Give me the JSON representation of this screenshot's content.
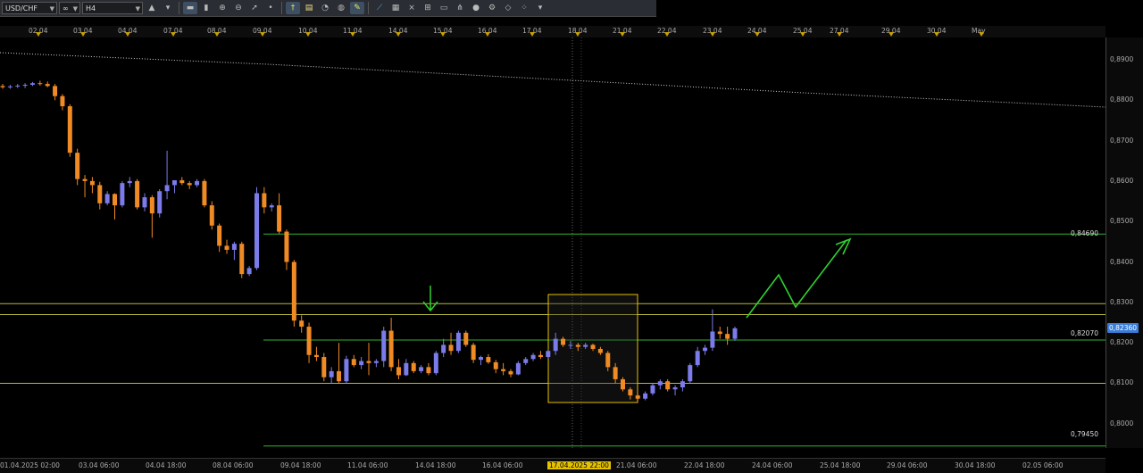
{
  "toolbar": {
    "symbol": "USD/CHF",
    "chart_style": "∞",
    "timeframe": "H4",
    "icons": [
      "chart-type-icon",
      "bar-chart-icon",
      "candle-chart-icon",
      "zoom-in-icon",
      "zoom-out-icon",
      "cursor-icon",
      "dot-icon",
      "crosshair-icon",
      "note-icon",
      "clock-icon",
      "globe-icon",
      "pencil-icon",
      "trendline-icon",
      "channel-icon",
      "fibonacci-icon",
      "grid-icon",
      "rect-icon",
      "pitchfork-icon",
      "circle-icon",
      "settings-icon",
      "eraser-icon",
      "more-icon"
    ]
  },
  "top_dates": [
    "02.04",
    "03.04",
    "04.04",
    "07.04",
    "08.04",
    "09.04",
    "10.04",
    "11.04",
    "14.04",
    "15.04",
    "16.04",
    "17.04",
    "18.04",
    "21.04",
    "22.04",
    "23.04",
    "24.04",
    "25.04",
    "27.04",
    "29.04",
    "30.04",
    "May"
  ],
  "bottom_dates": [
    "01.04.2025 02:00",
    "03.04 06:00",
    "04.04 18:00",
    "08.04 06:00",
    "09.04 18:00",
    "11.04 06:00",
    "14.04 18:00",
    "16.04 06:00",
    "17.04.2025 22:00",
    "21.04 06:00",
    "22.04 18:00",
    "24.04 06:00",
    "25.04 18:00",
    "29.04 06:00",
    "30.04 18:00",
    "02.05 06:00"
  ],
  "highlight_date": "17.04.2025 22:00",
  "y_ticks": [
    "0,8900",
    "0,8800",
    "0,8700",
    "0,8600",
    "0,8500",
    "0,8400",
    "0,8300",
    "0,8200",
    "0,8100",
    "0,8000"
  ],
  "levels": {
    "upper": "0,84690",
    "middle": "0,82070",
    "lower": "0,79450"
  },
  "current_price": "0,82360",
  "colors": {
    "bull": "#7b7bea",
    "bear": "#f08a24",
    "level_green": "#2fb52f",
    "level_yellow": "#b8b83a",
    "highlight": "#e6c200",
    "arrow_green": "#2fd12f",
    "price_tag": "#3a7dd8"
  },
  "chart_data": {
    "type": "candlestick",
    "title": "",
    "ylim": [
      0.794,
      0.8955
    ],
    "candles": [
      [
        0.8835,
        0.884,
        0.8828,
        0.8832
      ],
      [
        0.8832,
        0.8838,
        0.8828,
        0.8834
      ],
      [
        0.8834,
        0.884,
        0.883,
        0.8836
      ],
      [
        0.8836,
        0.8842,
        0.883,
        0.8838
      ],
      [
        0.8838,
        0.8845,
        0.8835,
        0.8842
      ],
      [
        0.8842,
        0.8848,
        0.8836,
        0.884
      ],
      [
        0.884,
        0.8846,
        0.8832,
        0.8835
      ],
      [
        0.8835,
        0.884,
        0.88,
        0.881
      ],
      [
        0.881,
        0.8815,
        0.8775,
        0.8785
      ],
      [
        0.8785,
        0.879,
        0.866,
        0.867
      ],
      [
        0.867,
        0.868,
        0.859,
        0.8605
      ],
      [
        0.8605,
        0.8615,
        0.856,
        0.86
      ],
      [
        0.86,
        0.861,
        0.857,
        0.859
      ],
      [
        0.859,
        0.8598,
        0.853,
        0.8545
      ],
      [
        0.8545,
        0.8575,
        0.854,
        0.8568
      ],
      [
        0.8568,
        0.857,
        0.8505,
        0.854
      ],
      [
        0.854,
        0.86,
        0.8535,
        0.8595
      ],
      [
        0.8595,
        0.861,
        0.8585,
        0.86
      ],
      [
        0.86,
        0.8605,
        0.853,
        0.8535
      ],
      [
        0.8535,
        0.857,
        0.8525,
        0.856
      ],
      [
        0.856,
        0.8565,
        0.846,
        0.852
      ],
      [
        0.852,
        0.858,
        0.851,
        0.8575
      ],
      [
        0.8575,
        0.8675,
        0.8555,
        0.859
      ],
      [
        0.859,
        0.8602,
        0.857,
        0.8602
      ],
      [
        0.8602,
        0.861,
        0.859,
        0.8595
      ],
      [
        0.8595,
        0.86,
        0.858,
        0.859
      ],
      [
        0.859,
        0.8605,
        0.8585,
        0.86
      ],
      [
        0.86,
        0.8605,
        0.8535,
        0.854
      ],
      [
        0.854,
        0.855,
        0.848,
        0.849
      ],
      [
        0.849,
        0.8495,
        0.8425,
        0.844
      ],
      [
        0.844,
        0.8455,
        0.842,
        0.843
      ],
      [
        0.843,
        0.845,
        0.8405,
        0.8445
      ],
      [
        0.8445,
        0.845,
        0.836,
        0.837
      ],
      [
        0.837,
        0.839,
        0.8365,
        0.8385
      ],
      [
        0.8385,
        0.8585,
        0.838,
        0.857
      ],
      [
        0.857,
        0.8585,
        0.852,
        0.8535
      ],
      [
        0.8535,
        0.8545,
        0.8525,
        0.854
      ],
      [
        0.854,
        0.857,
        0.847,
        0.8475
      ],
      [
        0.8475,
        0.848,
        0.838,
        0.84
      ],
      [
        0.84,
        0.8405,
        0.824,
        0.8255
      ],
      [
        0.8255,
        0.8268,
        0.8225,
        0.824
      ],
      [
        0.824,
        0.825,
        0.815,
        0.817
      ],
      [
        0.817,
        0.819,
        0.8155,
        0.8165
      ],
      [
        0.8165,
        0.8175,
        0.8105,
        0.8115
      ],
      [
        0.8115,
        0.814,
        0.81,
        0.813
      ],
      [
        0.813,
        0.82,
        0.81,
        0.8105
      ],
      [
        0.8105,
        0.8168,
        0.81,
        0.816
      ],
      [
        0.816,
        0.817,
        0.814,
        0.8145
      ],
      [
        0.8145,
        0.8165,
        0.8135,
        0.8155
      ],
      [
        0.8155,
        0.82,
        0.812,
        0.815
      ],
      [
        0.815,
        0.816,
        0.814,
        0.8155
      ],
      [
        0.8155,
        0.824,
        0.814,
        0.823
      ],
      [
        0.823,
        0.8262,
        0.813,
        0.814
      ],
      [
        0.814,
        0.816,
        0.811,
        0.812
      ],
      [
        0.812,
        0.816,
        0.8118,
        0.815
      ],
      [
        0.815,
        0.8155,
        0.8125,
        0.813
      ],
      [
        0.813,
        0.8145,
        0.8125,
        0.814
      ],
      [
        0.814,
        0.815,
        0.812,
        0.8125
      ],
      [
        0.8125,
        0.818,
        0.812,
        0.8175
      ],
      [
        0.8175,
        0.821,
        0.8165,
        0.8195
      ],
      [
        0.8195,
        0.8225,
        0.817,
        0.818
      ],
      [
        0.818,
        0.823,
        0.8175,
        0.8225
      ],
      [
        0.8225,
        0.823,
        0.819,
        0.8195
      ],
      [
        0.8195,
        0.82,
        0.815,
        0.8158
      ],
      [
        0.8158,
        0.8168,
        0.8145,
        0.8165
      ],
      [
        0.8165,
        0.8172,
        0.8148,
        0.8152
      ],
      [
        0.8152,
        0.8158,
        0.8125,
        0.8135
      ],
      [
        0.8135,
        0.815,
        0.812,
        0.813
      ],
      [
        0.813,
        0.8135,
        0.8115,
        0.8122
      ],
      [
        0.8122,
        0.8155,
        0.812,
        0.815
      ],
      [
        0.815,
        0.8165,
        0.8145,
        0.816
      ],
      [
        0.816,
        0.8175,
        0.8155,
        0.817
      ],
      [
        0.817,
        0.818,
        0.816,
        0.8165
      ],
      [
        0.8165,
        0.8185,
        0.816,
        0.818
      ],
      [
        0.818,
        0.8225,
        0.817,
        0.821
      ],
      [
        0.821,
        0.8215,
        0.819,
        0.8195
      ],
      [
        0.8195,
        0.8205,
        0.8185,
        0.8195
      ],
      [
        0.8195,
        0.82,
        0.818,
        0.819
      ],
      [
        0.819,
        0.82,
        0.8185,
        0.8195
      ],
      [
        0.8195,
        0.8198,
        0.818,
        0.8185
      ],
      [
        0.8185,
        0.819,
        0.817,
        0.8175
      ],
      [
        0.8175,
        0.818,
        0.813,
        0.814
      ],
      [
        0.814,
        0.815,
        0.81,
        0.811
      ],
      [
        0.811,
        0.8115,
        0.808,
        0.8085
      ],
      [
        0.8085,
        0.809,
        0.806,
        0.807
      ],
      [
        0.807,
        0.8075,
        0.8055,
        0.8062
      ],
      [
        0.8062,
        0.808,
        0.8058,
        0.8075
      ],
      [
        0.8075,
        0.81,
        0.807,
        0.8095
      ],
      [
        0.8095,
        0.811,
        0.8085,
        0.8105
      ],
      [
        0.8105,
        0.811,
        0.808,
        0.8085
      ],
      [
        0.8085,
        0.8095,
        0.807,
        0.809
      ],
      [
        0.809,
        0.811,
        0.808,
        0.8105
      ],
      [
        0.8105,
        0.815,
        0.81,
        0.8145
      ],
      [
        0.8145,
        0.819,
        0.814,
        0.818
      ],
      [
        0.818,
        0.8195,
        0.817,
        0.8188
      ],
      [
        0.8188,
        0.8283,
        0.818,
        0.8228
      ],
      [
        0.8228,
        0.824,
        0.821,
        0.8222
      ],
      [
        0.8222,
        0.824,
        0.8195,
        0.821
      ],
      [
        0.821,
        0.824,
        0.8205,
        0.8236
      ]
    ],
    "horizontal_levels": [
      0.8469,
      0.8297,
      0.827,
      0.8207,
      0.81,
      0.7945
    ],
    "current": 0.8236
  }
}
